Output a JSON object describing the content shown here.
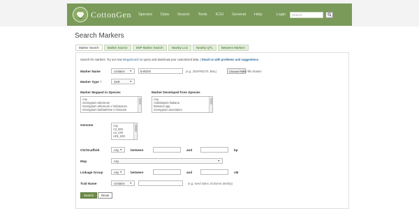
{
  "header": {
    "logo_text": "CottonGen",
    "nav": [
      "Species",
      "Data",
      "Search",
      "Tools",
      "ICGI",
      "General",
      "Help"
    ],
    "login": "Login",
    "search_placeholder": "Search",
    "color": "#7a9a5a"
  },
  "page": {
    "title": "Search Markers"
  },
  "tabs": [
    {
      "label": "Marker Search",
      "active": true
    },
    {
      "label": "Marker Source"
    },
    {
      "label": "SNP Marker Search"
    },
    {
      "label": "Nearby Loci"
    },
    {
      "label": "Nearby QTL"
    },
    {
      "label": "Between Markers"
    }
  ],
  "intro": {
    "prefix": "Search for markers. Try our new ",
    "link": "MegaSearch",
    "middle": " to query and download your customized data. | ",
    "email": "Email us with problems and suggestions"
  },
  "form": {
    "marker_name": {
      "label": "Marker Name",
      "operator": "contains",
      "value": "bnl0250",
      "hint": "(e.g. JESPR0270, BNL)",
      "file_button": "Choose File",
      "file_status": "No file chosen"
    },
    "marker_type": {
      "label": "Marker Type",
      "help_icon": "?",
      "value": "SSR"
    },
    "mapped_species": {
      "label": "Marker Mapped in Species",
      "options": [
        "Any",
        "Gossypium arboreum",
        "Gossypium arboreum x herbaceum",
        "Gossypium barbadense x hirsutum"
      ]
    },
    "developed_species": {
      "label": "Marker Developed from Species",
      "options": [
        "Any",
        "Arabidopsis thaliana",
        "Brassica spp.",
        "Gossypium anomalum"
      ]
    },
    "genome": {
      "label": "Genome",
      "options": [
        "Any",
        "A2_BGI",
        "A2_CRI",
        "AD1_BGI"
      ]
    },
    "chr_scaffold": {
      "label": "Chr/Scaffold",
      "value": "Any",
      "between": "between",
      "and": "and",
      "unit": "bp"
    },
    "map": {
      "label": "Map",
      "value": "Any"
    },
    "linkage_group": {
      "label": "Linkage Group",
      "value": "Any",
      "between": "between",
      "and": "and",
      "unit": "cM"
    },
    "trait_name": {
      "label": "Trait Name",
      "operator": "contains",
      "hint": "(e.g. seed index, trichome density)"
    }
  },
  "buttons": {
    "search": "Search",
    "reset": "Reset"
  }
}
